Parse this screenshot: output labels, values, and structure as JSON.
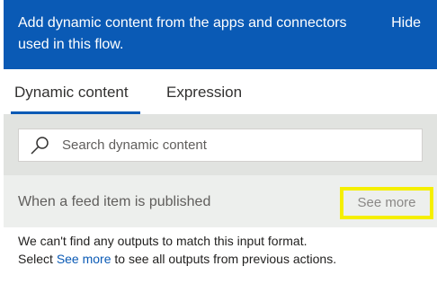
{
  "banner": {
    "text": "Add dynamic content from the apps and connectors used in this flow.",
    "hide_label": "Hide"
  },
  "tabs": [
    {
      "label": "Dynamic content",
      "active": true
    },
    {
      "label": "Expression",
      "active": false
    }
  ],
  "search": {
    "placeholder": "Search dynamic content",
    "value": ""
  },
  "section": {
    "title": "When a feed item is published",
    "see_more_label": "See more"
  },
  "message": {
    "line1": "We can't find any outputs to match this input format.",
    "line2_prefix": "Select",
    "line2_link": "See more",
    "line2_suffix": "to see all outputs from previous actions."
  },
  "colors": {
    "accent": "#0a5ab5",
    "highlight": "#f5ef00"
  }
}
